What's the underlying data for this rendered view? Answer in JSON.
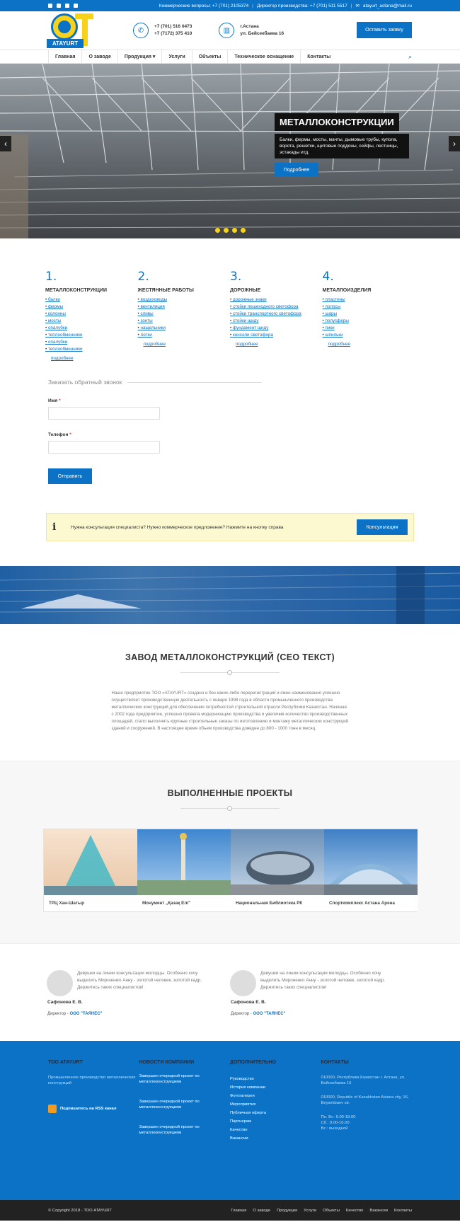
{
  "topbar": {
    "commercial": "Коммерческие вопросы: +7 (701) 2105374",
    "director": "Директор производства: +7 (701) 511 5517",
    "email": "atayurt_astana@mail.ru"
  },
  "header": {
    "logo_text": "ATAYURT",
    "phone1": "+7 (701) 516 0473",
    "phone2": "+7 (7172) 375 410",
    "city": "г.Астана",
    "street": "ул. Бейсекбаева 16",
    "cta": "Оставить заявку"
  },
  "nav": [
    "Главная",
    "О заводе",
    "Продукция ▾",
    "Услуги",
    "Объекты",
    "Техническое оснащение",
    "Контакты"
  ],
  "hero": {
    "title": "МЕТАЛЛОКОНСТРУКЦИИ",
    "text": "Балки, фермы, мосты, мачты, дымовые трубы, купола, ворота, решетки, щитовые поддоны, сейфы, лестницы, эстакады итд.",
    "button": "Подробнее"
  },
  "categories": [
    {
      "num": "1.",
      "title": "МЕТАЛЛОКОНСТРУКЦИИ",
      "items": [
        "балки",
        "фермы",
        "колонны",
        "мосты",
        "опалубки",
        "теплообменники",
        "опалубки",
        "теплообменники"
      ],
      "more": "подробнее"
    },
    {
      "num": "2.",
      "title": "ЖЕСТЯННЫЕ РАБОТЫ",
      "items": [
        "воздуховоды",
        "вентиляция",
        "сливы",
        "зонты",
        "нащельники",
        "лотки"
      ],
      "more": "подробнее"
    },
    {
      "num": "3.",
      "title": "ДОРОЖНЫЕ",
      "items": [
        "дорожные знаки",
        "стойки пешеходного светофора",
        "стойки транспортного светофора",
        "стойки щиду",
        "фундамент щиду",
        "консоли светофора"
      ],
      "more": "подробнее"
    },
    {
      "num": "4.",
      "title": "МЕТАЛЛОИЗДЕЛИЯ",
      "items": [
        "пластины",
        "полосы",
        "шары",
        "полусферы",
        "пики",
        "шпильки"
      ],
      "more": "подробнее"
    }
  ],
  "form": {
    "title": "Заказать обратный звонок",
    "name": "Имя",
    "phone": "Телефон",
    "star": "*",
    "submit": "Отправить"
  },
  "notice": {
    "icon": "i",
    "text": "Нужна консультация специалиста? Нужно коммерческое предложение? Нажмите на кнопку справа",
    "button": "Консультация"
  },
  "seo": {
    "title": "ЗАВОД МЕТАЛЛОКОНСТРУКЦИЙ (СЕО ТЕКСТ)",
    "text": "Наше предприятие ТОО «ATAYURT» создано и без каких-либо перерегистраций и смен наименования успешно осуществляет производственную деятельность с января 1998 года в области промышленного производства металлических конструкций для обеспечения потребностей строительной отрасли Республики Казахстан. Начиная с 2002 года предприятие, успешно провела модернизацию производства и увеличив количество производственных площадей, стало выполнять крупные строительные заказы по изготовлению и монтажу металлических конструкций зданий и сооружений. В настоящее время объем производства доведен до 800 - 1000 тонн в месяц."
  },
  "projects": {
    "title": "ВЫПОЛНЕННЫЕ ПРОЕКТЫ",
    "items": [
      "ТРЦ Хан-Шатыр",
      "Монумент „Қазақ Елі\"",
      "Национальная Библиотека РК",
      "Спорткомплекс Астана Арена"
    ]
  },
  "testimonials": [
    {
      "quote": "Девушки на линии консультации молодцы. Особенно хочу выделить Мироненко Анну - золотой человек, золотой кадр. Держитесь таких специалистов!",
      "author": "Сафонова Е. В.",
      "role": "Директор - ",
      "company": "ООО \"ТАЯНЕС\""
    },
    {
      "quote": "Девушки на линии консультации молодцы. Особенно хочу выделить Мироненко Анну - золотой человек, золотой кадр. Держитесь таких специалистов!",
      "author": "Сафонова Е. В.",
      "role": "Директор - ",
      "company": "ООО \"ТАЯНЕС\""
    }
  ],
  "footer": {
    "col1": {
      "title": "ТОО ATAYURT",
      "text": "Промышленное производство металлических конструкций",
      "rss": "Подпишитесь на RSS канал"
    },
    "col2": {
      "title": "НОВОСТИ КОМПАНИИ",
      "items": [
        "Завершен очередной проект по металлоконструкциям",
        "Завершен очередной проект по металлоконструкциям",
        "Завершен очередной проект по металлоконструкциям"
      ]
    },
    "col3": {
      "title": "ДОПОЛНИТЕЛЬНО",
      "items": [
        "Руководство",
        "История компании",
        "Фотогалерея",
        "Мероприятия",
        "Публичная оферта",
        "Партнерам",
        "Качество",
        "Вакансии"
      ]
    },
    "col4": {
      "title": "КОНТАКТЫ",
      "addr1": "010000, Республика Казахстан г. Астана, ул. Бейсекбаева 16",
      "addr2": "010000, Republic of Kazakhstan Astana city, 16, Beysekbaev str.",
      "hours1": "Пн. Вт.: 9.00-18.00",
      "hours2": "Сб.: 9.00-16.00",
      "hours3": "Вс.: выходной"
    }
  },
  "bottom": {
    "copyright": "© Copyright 2018 - ТОО ATAYURT",
    "links": [
      "Главная",
      "О заводе",
      "Продукция",
      "Услуги",
      "Объекты",
      "Качество",
      "Вакансии",
      "Контакты"
    ]
  },
  "colors": {
    "accent": "#0b72c6",
    "yellow": "#f7d21b",
    "dark": "#222222"
  }
}
